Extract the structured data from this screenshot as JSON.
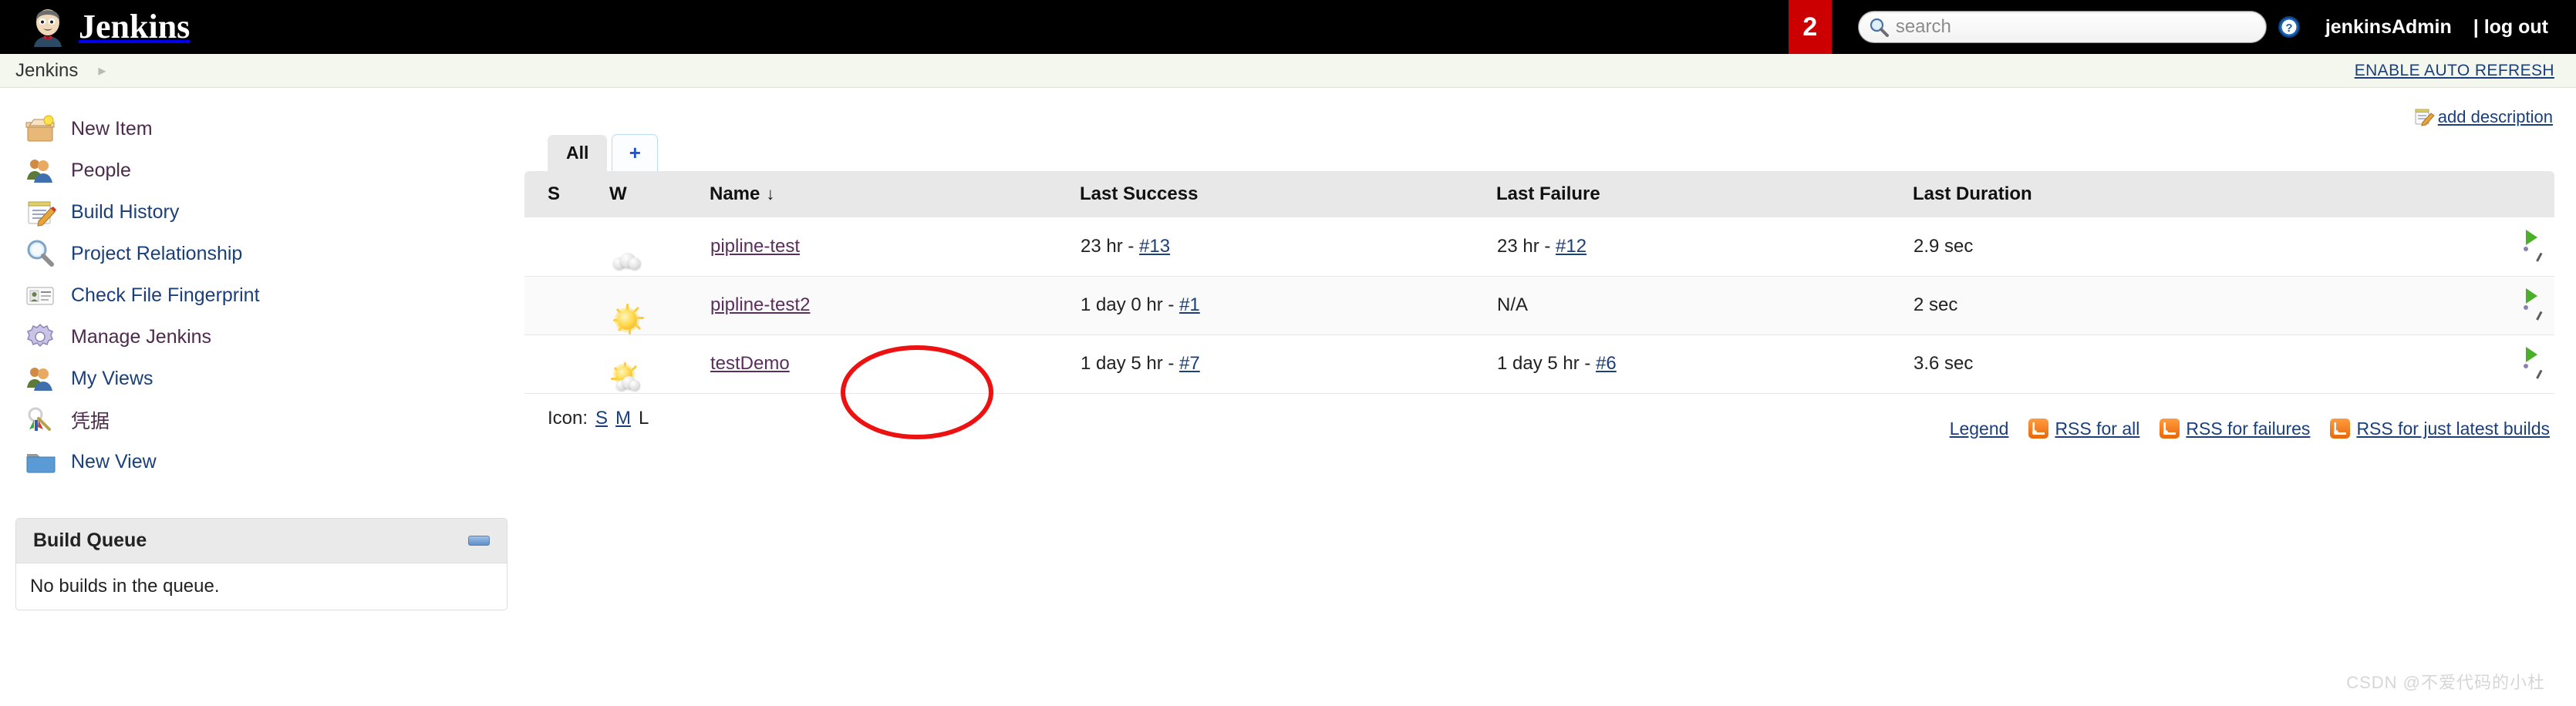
{
  "header": {
    "brand": "Jenkins",
    "notification_count": "2",
    "search_placeholder": "search",
    "search_value": "",
    "user": "jenkinsAdmin",
    "logout": "| log out",
    "icons": {
      "logo": "jenkins-butler-logo",
      "search": "search-icon",
      "help": "help-icon"
    }
  },
  "breadcrumb": {
    "root": "Jenkins",
    "chevron": "▸",
    "auto_refresh": "ENABLE AUTO REFRESH"
  },
  "sidebar": {
    "items": [
      {
        "label": "New Item",
        "icon": "new-item-icon"
      },
      {
        "label": "People",
        "icon": "people-icon"
      },
      {
        "label": "Build History",
        "icon": "build-history-icon"
      },
      {
        "label": "Project Relationship",
        "icon": "project-relationship-icon"
      },
      {
        "label": "Check File Fingerprint",
        "icon": "fingerprint-icon"
      },
      {
        "label": "Manage Jenkins",
        "icon": "gear-icon"
      },
      {
        "label": "My Views",
        "icon": "my-views-icon"
      },
      {
        "label": "凭据",
        "icon": "credentials-key-icon"
      },
      {
        "label": "New View",
        "icon": "folder-icon"
      }
    ],
    "build_queue": {
      "title": "Build Queue",
      "empty_text": "No builds in the queue.",
      "collapse_icon": "collapse-icon"
    }
  },
  "main": {
    "add_description": "add description",
    "add_description_icon": "edit-description-icon",
    "tabs": [
      {
        "label": "All",
        "active": true
      },
      {
        "label": "+",
        "active": false
      }
    ],
    "table": {
      "columns": [
        "S",
        "W",
        "Name",
        "Last Success",
        "Last Failure",
        "Last Duration"
      ],
      "sort_indicator": "↓",
      "sorted_column": "Name",
      "rows": [
        {
          "status": "blue-ball-icon",
          "weather": "cloudy-icon",
          "name": "pipline-test",
          "last_success_time": "23 hr - ",
          "last_success_build": "#13",
          "last_failure_time": "23 hr - ",
          "last_failure_build": "#12",
          "duration": "2.9 sec",
          "build_icon": "schedule-build-icon"
        },
        {
          "status": "blue-ball-icon",
          "weather": "sunny-icon",
          "name": "pipline-test2",
          "last_success_time": "1 day 0 hr - ",
          "last_success_build": "#1",
          "last_failure_time": "N/A",
          "last_failure_build": "",
          "duration": "2 sec",
          "build_icon": "schedule-build-icon"
        },
        {
          "status": "blue-ball-icon",
          "weather": "partly-cloudy-icon",
          "name": "testDemo",
          "last_success_time": "1 day 5 hr - ",
          "last_success_build": "#7",
          "last_failure_time": "1 day 5 hr - ",
          "last_failure_build": "#6",
          "duration": "3.6 sec",
          "build_icon": "schedule-build-icon"
        }
      ]
    },
    "icon_size": {
      "label": "Icon:",
      "options": [
        "S",
        "M",
        "L"
      ],
      "selected": "L"
    },
    "footer_links": [
      {
        "label": "Legend",
        "icon": ""
      },
      {
        "label": "RSS for all",
        "icon": "rss-icon"
      },
      {
        "label": "RSS for failures",
        "icon": "rss-icon"
      },
      {
        "label": "RSS for just latest builds",
        "icon": "rss-icon"
      }
    ]
  },
  "annotation": {
    "shape": "red-ellipse",
    "color": "#ee1111",
    "target": "testDemo"
  },
  "watermark": "CSDN @不爱代码的小杜"
}
